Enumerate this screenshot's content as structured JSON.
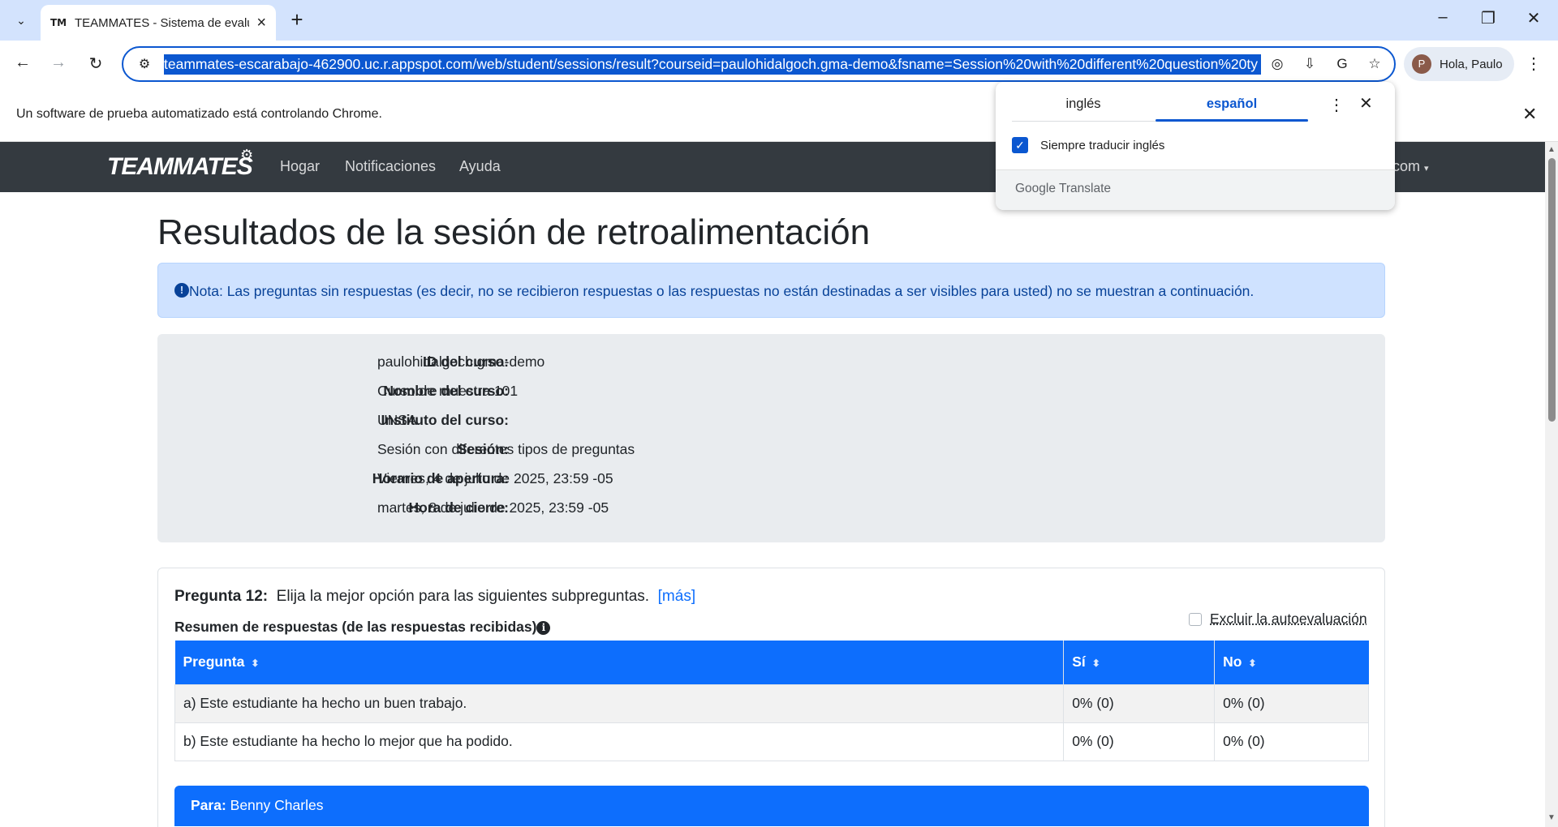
{
  "browser": {
    "tab_title": "TEAMMATES - Sistema de evalu",
    "tab_favicon": "TM",
    "url": "teammates-escarabajo-462900.uc.r.appspot.com/web/student/sessions/result?courseid=paulohidalgoch.gma-demo&fsname=Session%20with%20different%20question%20ty",
    "profile_label": "Hola, Paulo",
    "profile_initial": "P",
    "infobar_text": "Un software de prueba automatizado está controlando Chrome.",
    "icons": [
      "tab-search-icon",
      "close-icon",
      "new-tab-icon",
      "minimize-icon",
      "maximize-icon",
      "back-icon",
      "forward-icon",
      "reload-icon",
      "site-info-icon",
      "lens-icon",
      "install-icon",
      "translate-icon",
      "star-icon",
      "menu-icon"
    ]
  },
  "translate_popup": {
    "tab_source": "inglés",
    "tab_target": "español",
    "checkbox_label": "Siempre traducir inglés",
    "checkbox_checked": true,
    "brand": "Google Translate"
  },
  "navbar": {
    "brand": "TEAMMATES",
    "links": [
      "Hogar",
      "Notificaciones",
      "Ayuda"
    ],
    "user_suffix": "com"
  },
  "page": {
    "title": "Resultados de la sesión de retroalimentación",
    "alert": "Nota: Las preguntas sin respuestas (es decir, no se recibieron respuestas o las respuestas no están destinadas a ser visibles para usted) no se muestran a continuación."
  },
  "course_info": [
    {
      "label": "ID del curso:",
      "value": "paulohidalgoch.gma-demo"
    },
    {
      "label": "Nombre del curso:",
      "value": "Curso de muestra 101"
    },
    {
      "label": "Instituto del curso:",
      "value": "UNSA"
    },
    {
      "label": "Sesión:",
      "value": "Sesión con diferentes tipos de preguntas"
    },
    {
      "label": "Horario de apertura:",
      "value": "Viernes, 4 de julio de 2025, 23:59 -05"
    },
    {
      "label": "Hora de cierre:",
      "value": "martes, 8 de julio de 2025, 23:59 -05"
    }
  ],
  "question": {
    "number_label": "Pregunta 12:",
    "text": "Elija la mejor opción para las siguientes subpreguntas.",
    "more_link": "[más]",
    "summary_label": "Resumen de respuestas (de las respuestas recibidas)",
    "exclude_self_label": "Excluir la autoevaluación",
    "exclude_self_checked": false,
    "table": {
      "headers": [
        "Pregunta",
        "Sí",
        "No"
      ],
      "rows": [
        [
          "a) Este estudiante ha hecho un buen trabajo.",
          "0% (0)",
          "0% (0)"
        ],
        [
          "b) Este estudiante ha hecho lo mejor que ha podido.",
          "0% (0)",
          "0% (0)"
        ]
      ]
    },
    "recipient_prefix": "Para:",
    "recipient_name": "Benny Charles"
  },
  "colors": {
    "primary": "#0d6efd",
    "navbar": "#343a40",
    "alert_bg": "#cfe2ff",
    "chrome_accent": "#0b57d0"
  }
}
